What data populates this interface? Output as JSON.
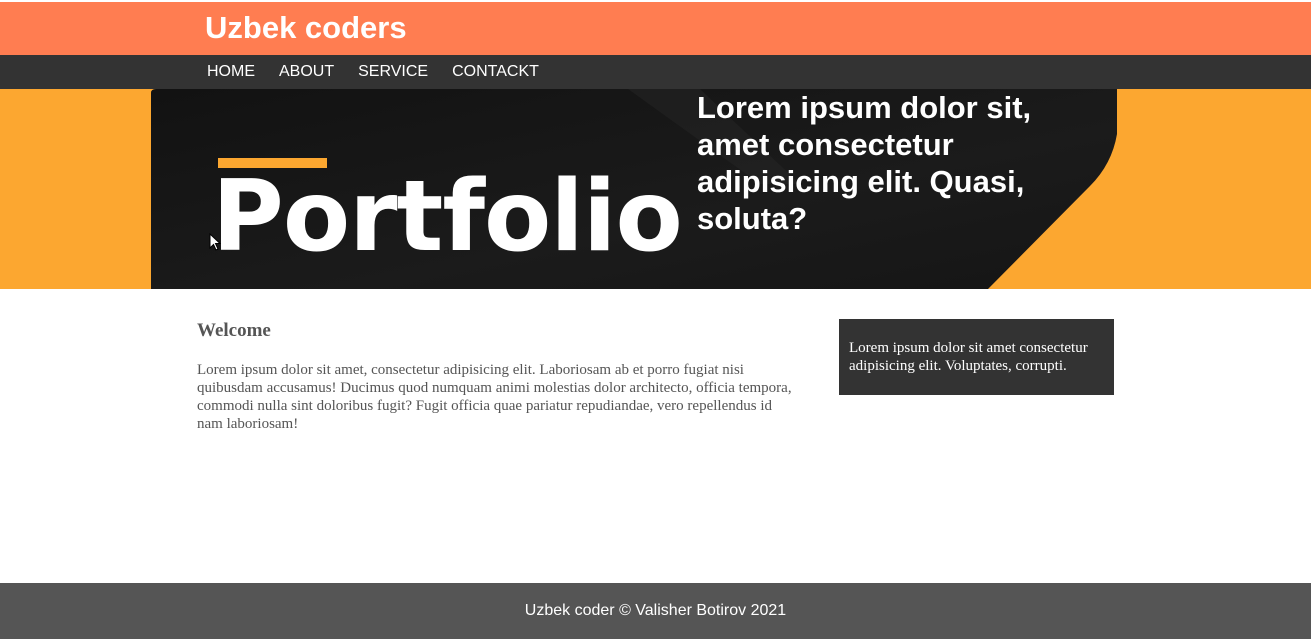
{
  "header": {
    "site_title": "Uzbek coders"
  },
  "nav": {
    "items": [
      {
        "label": "HOME"
      },
      {
        "label": "ABOUT"
      },
      {
        "label": "SERVICE"
      },
      {
        "label": "CONTACKT"
      }
    ]
  },
  "hero": {
    "banner_word": "Portfolio",
    "heading": "Lorem ipsum dolor sit, amet consectetur adipisicing elit. Quasi, soluta?"
  },
  "main": {
    "welcome_title": "Welcome",
    "welcome_text": "Lorem ipsum dolor sit amet, consectetur adipisicing elit. Laboriosam ab et porro fugiat nisi quibusdam accusamus! Ducimus quod numquam animi molestias dolor architecto, officia tempora, commodi nulla sint doloribus fugit? Fugit officia quae pariatur repudiandae, vero repellendus id nam laboriosam!"
  },
  "sidebar": {
    "box_text": "Lorem ipsum dolor sit amet consectetur adipisicing elit. Voluptates, corrupti."
  },
  "footer": {
    "text": "Uzbek coder © Valisher Botirov 2021"
  },
  "colors": {
    "brand_orange": "#ff7d51",
    "nav_dark": "#333333",
    "hero_orange": "#fca730",
    "hero_dark": "#141414",
    "footer_gray": "#555555"
  },
  "icons": {
    "cursor": "mouse-pointer-icon"
  }
}
